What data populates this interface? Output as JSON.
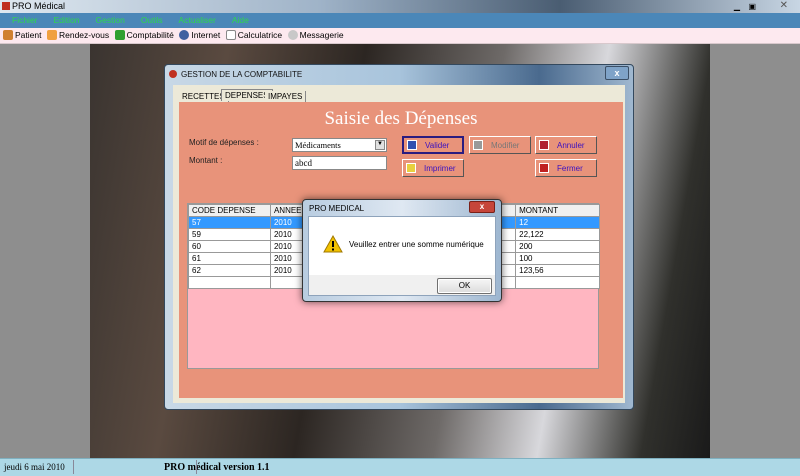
{
  "app": {
    "title": "PRO Médical"
  },
  "menu": [
    "Fichier",
    "Edition",
    "Gestion",
    "Outils",
    "Actualiser",
    "Aide"
  ],
  "toolbar": [
    {
      "label": "Patient",
      "icon": "patient-icon",
      "color": "#d08030"
    },
    {
      "label": "Rendez-vous",
      "icon": "calendar-icon",
      "color": "#f0a040"
    },
    {
      "label": "Comptabilité",
      "icon": "accounting-icon",
      "color": "#30a030"
    },
    {
      "label": "Internet",
      "icon": "globe-icon",
      "color": "#4060a0"
    },
    {
      "label": "Calculatrice",
      "icon": "calculator-icon",
      "color": "#b0b0b0"
    },
    {
      "label": "Messagerie",
      "icon": "mail-icon",
      "color": "#c0c0c0"
    }
  ],
  "window": {
    "title": "GESTION DE LA COMPTABILITE",
    "tabs": [
      "RECETTES",
      "DEPENSES",
      "IMPAYES"
    ],
    "heading": "Saisie des Dépenses",
    "motif_label": "Motif de dépenses :",
    "motif_value": "Médicaments",
    "montant_label": "Montant :",
    "montant_value": "abcd",
    "buttons": {
      "valider": "Valider",
      "modifier": "Modifier",
      "annuler": "Annuler",
      "imprimer": "Imprimer",
      "fermer": "Fermer"
    },
    "grid": {
      "columns": [
        "CODE DEPENSE",
        "ANNEE",
        "",
        "",
        "MONTANT"
      ],
      "rows": [
        [
          "57",
          "2010",
          "",
          "",
          "12"
        ],
        [
          "59",
          "2010",
          "",
          "",
          "22,122"
        ],
        [
          "60",
          "2010",
          "",
          "",
          "200"
        ],
        [
          "61",
          "2010",
          "",
          "",
          "100"
        ],
        [
          "62",
          "2010",
          "",
          "",
          "123,56"
        ]
      ]
    }
  },
  "dialog": {
    "title": "PRO MEDICAL",
    "message": "Veuillez entrer une somme numérique",
    "ok": "OK"
  },
  "status": {
    "date": "jeudi 6 mai 2010",
    "version": "PRO médical version 1.1"
  }
}
